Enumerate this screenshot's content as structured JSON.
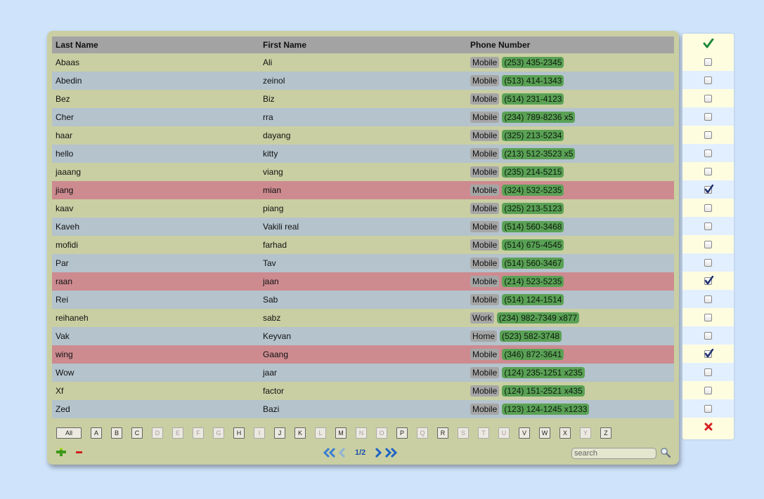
{
  "columns": {
    "last_name": "Last Name",
    "first_name": "First Name",
    "phone": "Phone Number"
  },
  "rows": [
    {
      "last": "Abaas",
      "first": "Ali",
      "type": "Mobile",
      "number": "(253) 435-2345",
      "selected": false
    },
    {
      "last": "Abedin",
      "first": "zeinol",
      "type": "Mobile",
      "number": "(513) 414-1343",
      "selected": false
    },
    {
      "last": "Bez",
      "first": "Biz",
      "type": "Mobile",
      "number": "(514) 231-4123",
      "selected": false
    },
    {
      "last": "Cher",
      "first": "rra",
      "type": "Mobile",
      "number": "(234) 789-8236 x5",
      "selected": false
    },
    {
      "last": "haar",
      "first": "dayang",
      "type": "Mobile",
      "number": "(325) 213-5234",
      "selected": false
    },
    {
      "last": "hello",
      "first": "kitty",
      "type": "Mobile",
      "number": "(213) 512-3523 x5",
      "selected": false
    },
    {
      "last": "jaaang",
      "first": "viang",
      "type": "Mobile",
      "number": "(235) 214-5215",
      "selected": false
    },
    {
      "last": "jiang",
      "first": "mian",
      "type": "Mobile",
      "number": "(324) 532-5235",
      "selected": true
    },
    {
      "last": "kaav",
      "first": "piang",
      "type": "Mobile",
      "number": "(325) 213-5123",
      "selected": false
    },
    {
      "last": "Kaveh",
      "first": "Vakili real",
      "type": "Mobile",
      "number": "(514) 560-3468",
      "selected": false
    },
    {
      "last": "mofidi",
      "first": "farhad",
      "type": "Mobile",
      "number": "(514) 675-4545",
      "selected": false
    },
    {
      "last": "Par",
      "first": "Tav",
      "type": "Mobile",
      "number": "(514) 560-3467",
      "selected": false
    },
    {
      "last": "raan",
      "first": "jaan",
      "type": "Mobile",
      "number": "(214) 523-5235",
      "selected": true
    },
    {
      "last": "Rei",
      "first": "Sab",
      "type": "Mobile",
      "number": "(514) 124-1514",
      "selected": false
    },
    {
      "last": "reihaneh",
      "first": "sabz",
      "type": "Work",
      "number": "(234) 982-7349 x877",
      "selected": false
    },
    {
      "last": "Vak",
      "first": "Keyvan",
      "type": "Home",
      "number": "(523) 582-3748",
      "selected": false
    },
    {
      "last": "wing",
      "first": "Gaang",
      "type": "Mobile",
      "number": "(346) 872-3641",
      "selected": true
    },
    {
      "last": "Wow",
      "first": "jaar",
      "type": "Mobile",
      "number": "(124) 235-1251 x235",
      "selected": false
    },
    {
      "last": "Xf",
      "first": "factor",
      "type": "Mobile",
      "number": "(124) 151-2521 x435",
      "selected": false
    },
    {
      "last": "Zed",
      "first": "Bazi",
      "type": "Mobile",
      "number": "(123) 124-1245 x1233",
      "selected": false
    }
  ],
  "letters": [
    {
      "label": "All",
      "enabled": true
    },
    {
      "label": "A",
      "enabled": true
    },
    {
      "label": "B",
      "enabled": true
    },
    {
      "label": "C",
      "enabled": true
    },
    {
      "label": "D",
      "enabled": false
    },
    {
      "label": "E",
      "enabled": false
    },
    {
      "label": "F",
      "enabled": false
    },
    {
      "label": "G",
      "enabled": false
    },
    {
      "label": "H",
      "enabled": true
    },
    {
      "label": "I",
      "enabled": false
    },
    {
      "label": "J",
      "enabled": true
    },
    {
      "label": "K",
      "enabled": true
    },
    {
      "label": "L",
      "enabled": false
    },
    {
      "label": "M",
      "enabled": true
    },
    {
      "label": "N",
      "enabled": false
    },
    {
      "label": "O",
      "enabled": false
    },
    {
      "label": "P",
      "enabled": true
    },
    {
      "label": "Q",
      "enabled": false
    },
    {
      "label": "R",
      "enabled": true
    },
    {
      "label": "S",
      "enabled": false
    },
    {
      "label": "T",
      "enabled": false
    },
    {
      "label": "U",
      "enabled": false
    },
    {
      "label": "V",
      "enabled": true
    },
    {
      "label": "W",
      "enabled": true
    },
    {
      "label": "X",
      "enabled": true
    },
    {
      "label": "Y",
      "enabled": false
    },
    {
      "label": "Z",
      "enabled": true
    }
  ],
  "pager": {
    "page_info": "1/2"
  },
  "search": {
    "placeholder": "search",
    "value": ""
  },
  "icons": {
    "confirm": "check-icon",
    "cancel": "close-icon",
    "add": "plus-icon",
    "delete": "minus-icon",
    "search": "magnifier-icon",
    "first_page": "double-chevron-left-icon",
    "prev_page": "chevron-left-icon",
    "next_page": "chevron-right-icon",
    "last_page": "double-chevron-right-icon"
  },
  "colors": {
    "background": "#cfe3fb",
    "panel": "#c9cfa2",
    "row_alt": "#b4c3cc",
    "row_selected": "#cd8b90",
    "header": "#a3a3a3",
    "phone_badge": "#5aa155",
    "type_badge": "#a6a6a6",
    "pager": "#2f73c8"
  }
}
